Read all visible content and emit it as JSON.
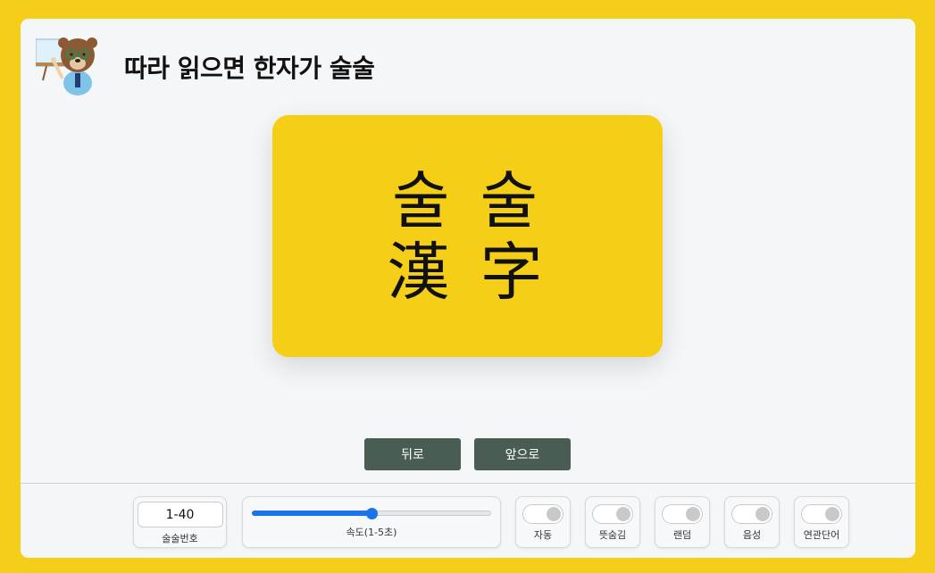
{
  "header": {
    "title": "따라 읽으면 한자가 술술"
  },
  "card": {
    "line1": "술 술",
    "line2": "漢 字"
  },
  "nav": {
    "prev_label": "뒤로",
    "next_label": "앞으로"
  },
  "controls": {
    "range": {
      "value": "1-40",
      "label": "술술번호"
    },
    "speed": {
      "label": "속도(1-5초)",
      "fraction": 0.5
    },
    "toggles": [
      {
        "label": "자동",
        "on": false
      },
      {
        "label": "뜻숨김",
        "on": false
      },
      {
        "label": "랜덤",
        "on": false
      },
      {
        "label": "음성",
        "on": false
      },
      {
        "label": "연관단어",
        "on": false
      }
    ]
  },
  "colors": {
    "background": "#f5ce19",
    "card": "#f4ce17",
    "nav_button": "#4a5d55",
    "slider_accent": "#1a73e8"
  }
}
